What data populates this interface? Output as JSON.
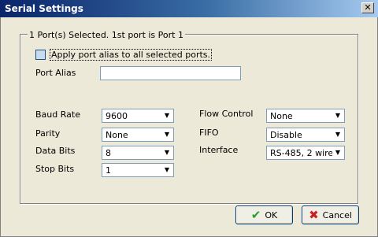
{
  "window": {
    "title": "Serial Settings",
    "close_glyph": "✕"
  },
  "group": {
    "title": "1 Port(s) Selected. 1st port is Port 1"
  },
  "apply_alias": {
    "label": "Apply port alias to all selected ports.",
    "checked": false
  },
  "port_alias": {
    "label": "Port Alias",
    "value": ""
  },
  "left_fields": [
    {
      "label": "Baud Rate",
      "value": "9600"
    },
    {
      "label": "Parity",
      "value": "None"
    },
    {
      "label": "Data Bits",
      "value": "8"
    },
    {
      "label": "Stop Bits",
      "value": "1"
    }
  ],
  "right_fields": [
    {
      "label": "Flow Control",
      "value": "None"
    },
    {
      "label": "FIFO",
      "value": "Disable"
    },
    {
      "label": "Interface",
      "value": "RS-485, 2 wire"
    }
  ],
  "combo_arrow_glyph": "▼",
  "buttons": {
    "ok_label": "OK",
    "ok_icon": "✔",
    "cancel_label": "Cancel",
    "cancel_icon": "✖"
  },
  "colors": {
    "title_bar_start": "#0a246a",
    "title_bar_end": "#a6caf0",
    "dialog_bg": "#ece9d8"
  }
}
